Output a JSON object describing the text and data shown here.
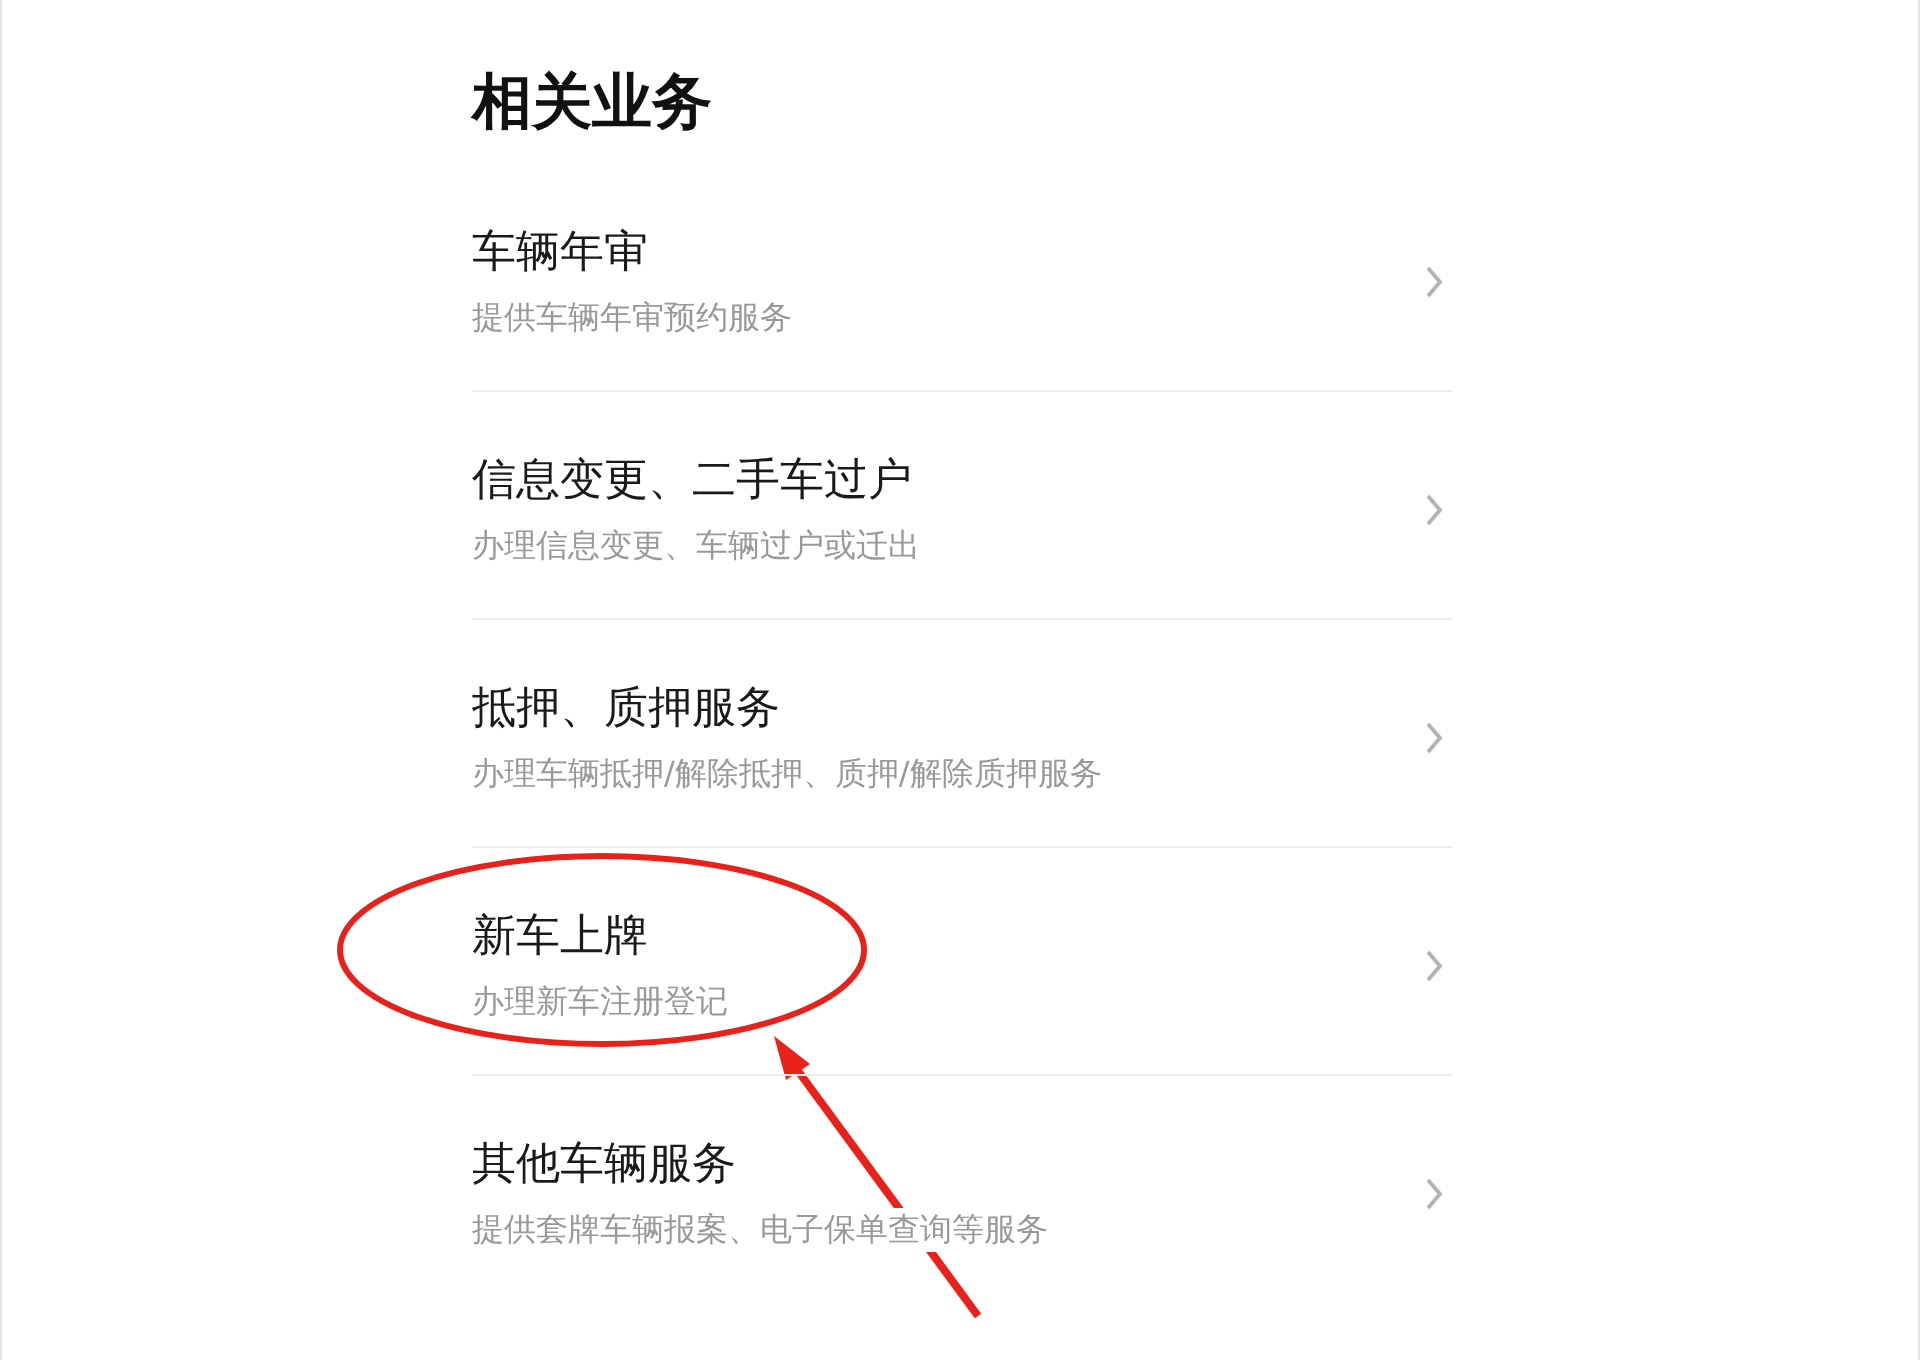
{
  "section_title": "相关业务",
  "items": [
    {
      "title": "车辆年审",
      "subtitle": "提供车辆年审预约服务"
    },
    {
      "title": "信息变更、二手车过户",
      "subtitle": "办理信息变更、车辆过户或迁出"
    },
    {
      "title": "抵押、质押服务",
      "subtitle": "办理车辆抵押/解除抵押、质押/解除质押服务"
    },
    {
      "title": "新车上牌",
      "subtitle": "办理新车注册登记"
    },
    {
      "title": "其他车辆服务",
      "subtitle": "提供套牌车辆报案、电子保单查询等服务"
    }
  ]
}
